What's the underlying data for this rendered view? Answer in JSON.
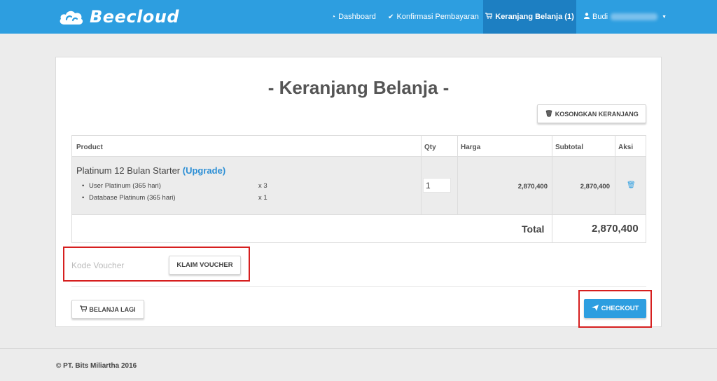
{
  "brand": {
    "name": "Beecloud"
  },
  "nav": {
    "dashboard": "Dashboard",
    "konfirmasi": "Konfirmasi Pembayaran",
    "keranjang": "Keranjang Belanja (1)",
    "user": "Budi"
  },
  "page": {
    "title": "- Keranjang Belanja -",
    "empty_cart_button": "KOSONGKAN KERANJANG"
  },
  "table": {
    "headers": {
      "product": "Product",
      "qty": "Qty",
      "price": "Harga",
      "subtotal": "Subtotal",
      "action": "Aksi"
    },
    "item": {
      "name": "Platinum 12 Bulan Starter",
      "upgrade": "(Upgrade)",
      "features": [
        {
          "label": "User Platinum (365 hari)",
          "qty": "x 3"
        },
        {
          "label": "Database Platinum (365 hari)",
          "qty": "x 1"
        }
      ],
      "qty": "1",
      "price": "2,870,400",
      "subtotal": "2,870,400"
    },
    "total_label": "Total",
    "total_value": "2,870,400"
  },
  "voucher": {
    "placeholder": "Kode Voucher",
    "button": "KLAIM VOUCHER"
  },
  "actions": {
    "continue_shopping": "BELANJA LAGI",
    "checkout": "CHECKOUT"
  },
  "footer": {
    "copyright": "© PT. Bits Miliartha 2016"
  },
  "colors": {
    "primary": "#2d9ee0",
    "nav_active": "#1d7fc2",
    "highlight": "#d61f1f",
    "background": "#ececec"
  }
}
